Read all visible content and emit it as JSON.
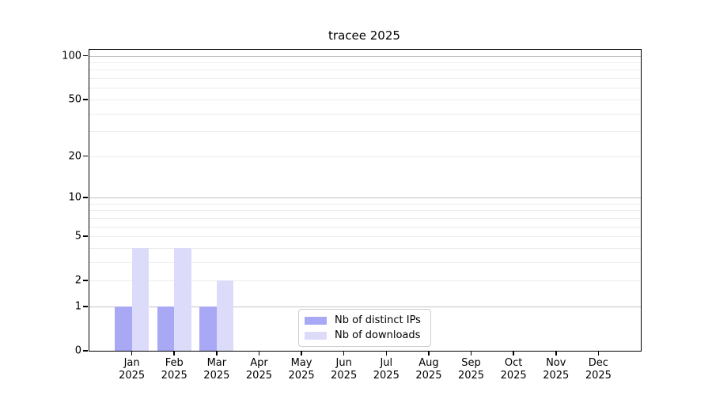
{
  "chart_data": {
    "type": "bar",
    "title": "tracee 2025",
    "categories": [
      "Jan",
      "Feb",
      "Mar",
      "Apr",
      "May",
      "Jun",
      "Jul",
      "Aug",
      "Sep",
      "Oct",
      "Nov",
      "Dec"
    ],
    "category_year": "2025",
    "series": [
      {
        "name": "Nb of distinct IPs",
        "color": "#a8a8f4",
        "values": [
          1,
          1,
          1,
          0,
          0,
          0,
          0,
          0,
          0,
          0,
          0,
          0
        ]
      },
      {
        "name": "Nb of downloads",
        "color": "#dcdcfa",
        "values": [
          4,
          4,
          2,
          0,
          0,
          0,
          0,
          0,
          0,
          0,
          0,
          0
        ]
      }
    ],
    "yscale": "log10(1+v)",
    "ylim": [
      0,
      110
    ],
    "ytick_values": [
      100,
      50,
      20,
      10,
      5,
      2,
      1,
      0
    ],
    "gridlines": {
      "major": [
        1,
        10,
        100
      ],
      "minor": [
        2,
        3,
        4,
        5,
        6,
        7,
        8,
        9,
        20,
        30,
        40,
        50,
        60,
        70,
        80,
        90
      ],
      "major_color": "#c3c3c3",
      "minor_color": "#ececec"
    },
    "legend": {
      "position": "lower center"
    },
    "axis_color": "#000000",
    "background_color": "#ffffff"
  }
}
